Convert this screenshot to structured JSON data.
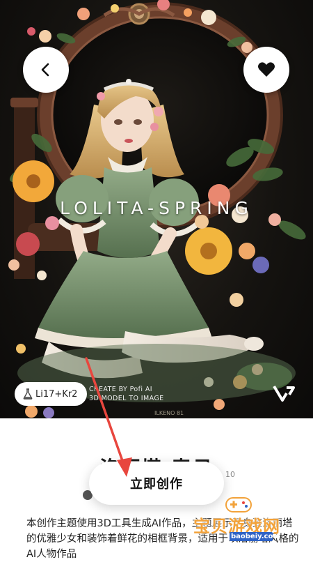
{
  "hero": {
    "title": "LOLITA-SPRING",
    "model_chip": "Li17+Kr2",
    "credit_line1": "CREATE BY Pofi AI",
    "credit_line2": "3D MODEL TO IMAGE",
    "image_caption": "ILKENO 81",
    "icons": {
      "back": "chevron-left-icon",
      "favorite": "heart-icon",
      "model": "flask-icon",
      "brand": "pofi-logo-icon"
    }
  },
  "sheet": {
    "title": "洛丽塔-春日",
    "usage_count": "10",
    "create_button": "立即创作",
    "description": "本创作主题使用3D工具生成AI作品，主题展示了身姿洛丽塔的优雅少女和装饰着鲜花的相框背景，适用于以洛丽塔风格的AI人物作品"
  },
  "watermark": {
    "site_name": "宝贝游戏网",
    "site_url": "baobeiy.com"
  },
  "colors": {
    "accent_arrow": "#e8463e",
    "dress": "#7f9a76",
    "flowers": "#f0a43a",
    "watermark": "#f2a23a"
  }
}
